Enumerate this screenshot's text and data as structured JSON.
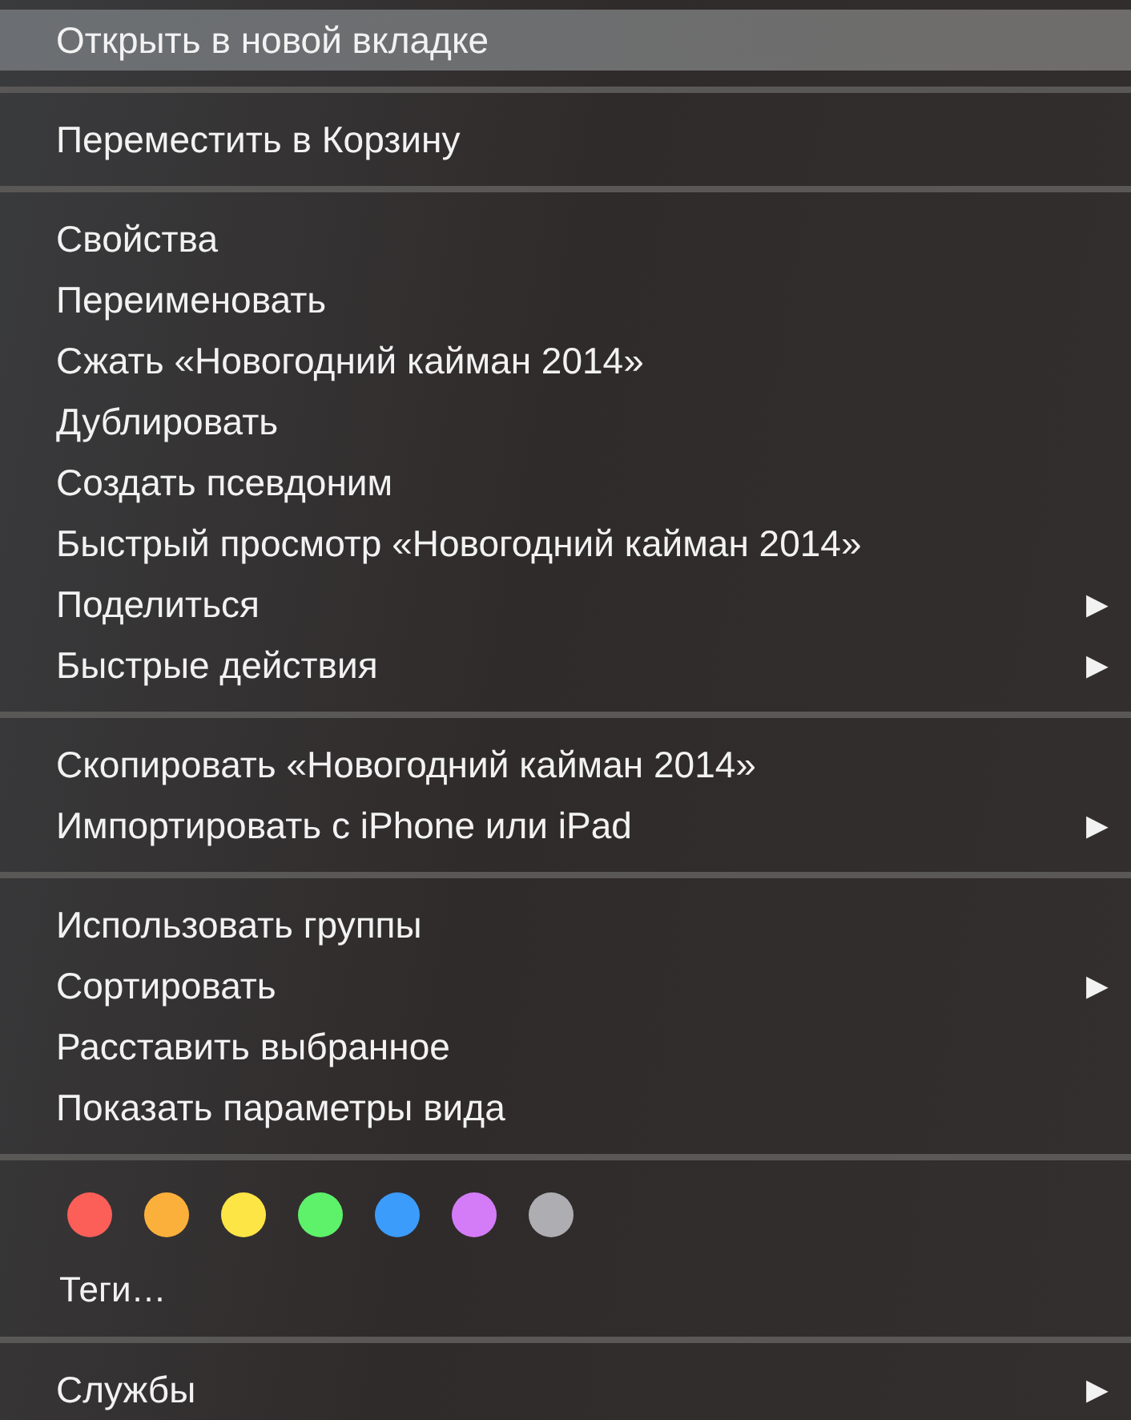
{
  "menu": {
    "sections": [
      {
        "kind": "items",
        "items": [
          {
            "label": "Открыть в новой вкладке",
            "selected": true
          }
        ]
      },
      {
        "kind": "items",
        "items": [
          {
            "label": "Переместить в Корзину",
            "selected": false
          }
        ]
      },
      {
        "kind": "items",
        "items": [
          {
            "label": "Свойства",
            "selected": false
          },
          {
            "label": "Переименовать",
            "selected": false
          },
          {
            "label": "Сжать «Новогодний кайман 2014»",
            "selected": false
          },
          {
            "label": "Дублировать",
            "selected": false
          },
          {
            "label": "Создать псевдоним",
            "selected": false
          },
          {
            "label": "Быстрый просмотр «Новогодний кайман 2014»",
            "selected": false
          },
          {
            "label": "Поделиться",
            "selected": false,
            "submenu": "▶"
          },
          {
            "label": "Быстрые действия",
            "selected": false,
            "submenu": "▶"
          }
        ]
      },
      {
        "kind": "items",
        "items": [
          {
            "label": "Скопировать «Новогодний кайман 2014»",
            "selected": false
          },
          {
            "label": "Импортировать с iPhone или iPad",
            "selected": false,
            "submenu": "▶"
          }
        ]
      },
      {
        "kind": "items",
        "items": [
          {
            "label": "Использовать группы",
            "selected": false
          },
          {
            "label": "Сортировать",
            "selected": false,
            "submenu": "▶"
          },
          {
            "label": "Расставить выбранное",
            "selected": false
          },
          {
            "label": "Показать параметры вида",
            "selected": false
          }
        ]
      },
      {
        "kind": "tags",
        "tags": [
          {
            "color": "#fb5f58"
          },
          {
            "color": "#fcb03c"
          },
          {
            "color": "#fde545"
          },
          {
            "color": "#5ef16a"
          },
          {
            "color": "#3b9cfb"
          },
          {
            "color": "#d47cf8"
          },
          {
            "color": "#aeadb2"
          }
        ],
        "label": "Теги…"
      },
      {
        "kind": "items",
        "items": [
          {
            "label": "Службы",
            "selected": false,
            "submenu": "▶"
          }
        ]
      }
    ]
  }
}
